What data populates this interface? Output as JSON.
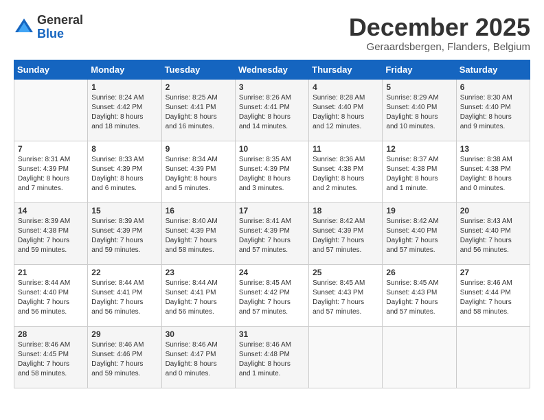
{
  "header": {
    "logo_line1": "General",
    "logo_line2": "Blue",
    "month_year": "December 2025",
    "location": "Geraardsbergen, Flanders, Belgium"
  },
  "weekdays": [
    "Sunday",
    "Monday",
    "Tuesday",
    "Wednesday",
    "Thursday",
    "Friday",
    "Saturday"
  ],
  "weeks": [
    [
      {
        "day": "",
        "info": ""
      },
      {
        "day": "1",
        "info": "Sunrise: 8:24 AM\nSunset: 4:42 PM\nDaylight: 8 hours\nand 18 minutes."
      },
      {
        "day": "2",
        "info": "Sunrise: 8:25 AM\nSunset: 4:41 PM\nDaylight: 8 hours\nand 16 minutes."
      },
      {
        "day": "3",
        "info": "Sunrise: 8:26 AM\nSunset: 4:41 PM\nDaylight: 8 hours\nand 14 minutes."
      },
      {
        "day": "4",
        "info": "Sunrise: 8:28 AM\nSunset: 4:40 PM\nDaylight: 8 hours\nand 12 minutes."
      },
      {
        "day": "5",
        "info": "Sunrise: 8:29 AM\nSunset: 4:40 PM\nDaylight: 8 hours\nand 10 minutes."
      },
      {
        "day": "6",
        "info": "Sunrise: 8:30 AM\nSunset: 4:40 PM\nDaylight: 8 hours\nand 9 minutes."
      }
    ],
    [
      {
        "day": "7",
        "info": "Sunrise: 8:31 AM\nSunset: 4:39 PM\nDaylight: 8 hours\nand 7 minutes."
      },
      {
        "day": "8",
        "info": "Sunrise: 8:33 AM\nSunset: 4:39 PM\nDaylight: 8 hours\nand 6 minutes."
      },
      {
        "day": "9",
        "info": "Sunrise: 8:34 AM\nSunset: 4:39 PM\nDaylight: 8 hours\nand 5 minutes."
      },
      {
        "day": "10",
        "info": "Sunrise: 8:35 AM\nSunset: 4:39 PM\nDaylight: 8 hours\nand 3 minutes."
      },
      {
        "day": "11",
        "info": "Sunrise: 8:36 AM\nSunset: 4:38 PM\nDaylight: 8 hours\nand 2 minutes."
      },
      {
        "day": "12",
        "info": "Sunrise: 8:37 AM\nSunset: 4:38 PM\nDaylight: 8 hours\nand 1 minute."
      },
      {
        "day": "13",
        "info": "Sunrise: 8:38 AM\nSunset: 4:38 PM\nDaylight: 8 hours\nand 0 minutes."
      }
    ],
    [
      {
        "day": "14",
        "info": "Sunrise: 8:39 AM\nSunset: 4:38 PM\nDaylight: 7 hours\nand 59 minutes."
      },
      {
        "day": "15",
        "info": "Sunrise: 8:39 AM\nSunset: 4:39 PM\nDaylight: 7 hours\nand 59 minutes."
      },
      {
        "day": "16",
        "info": "Sunrise: 8:40 AM\nSunset: 4:39 PM\nDaylight: 7 hours\nand 58 minutes."
      },
      {
        "day": "17",
        "info": "Sunrise: 8:41 AM\nSunset: 4:39 PM\nDaylight: 7 hours\nand 57 minutes."
      },
      {
        "day": "18",
        "info": "Sunrise: 8:42 AM\nSunset: 4:39 PM\nDaylight: 7 hours\nand 57 minutes."
      },
      {
        "day": "19",
        "info": "Sunrise: 8:42 AM\nSunset: 4:40 PM\nDaylight: 7 hours\nand 57 minutes."
      },
      {
        "day": "20",
        "info": "Sunrise: 8:43 AM\nSunset: 4:40 PM\nDaylight: 7 hours\nand 56 minutes."
      }
    ],
    [
      {
        "day": "21",
        "info": "Sunrise: 8:44 AM\nSunset: 4:40 PM\nDaylight: 7 hours\nand 56 minutes."
      },
      {
        "day": "22",
        "info": "Sunrise: 8:44 AM\nSunset: 4:41 PM\nDaylight: 7 hours\nand 56 minutes."
      },
      {
        "day": "23",
        "info": "Sunrise: 8:44 AM\nSunset: 4:41 PM\nDaylight: 7 hours\nand 56 minutes."
      },
      {
        "day": "24",
        "info": "Sunrise: 8:45 AM\nSunset: 4:42 PM\nDaylight: 7 hours\nand 57 minutes."
      },
      {
        "day": "25",
        "info": "Sunrise: 8:45 AM\nSunset: 4:43 PM\nDaylight: 7 hours\nand 57 minutes."
      },
      {
        "day": "26",
        "info": "Sunrise: 8:45 AM\nSunset: 4:43 PM\nDaylight: 7 hours\nand 57 minutes."
      },
      {
        "day": "27",
        "info": "Sunrise: 8:46 AM\nSunset: 4:44 PM\nDaylight: 7 hours\nand 58 minutes."
      }
    ],
    [
      {
        "day": "28",
        "info": "Sunrise: 8:46 AM\nSunset: 4:45 PM\nDaylight: 7 hours\nand 58 minutes."
      },
      {
        "day": "29",
        "info": "Sunrise: 8:46 AM\nSunset: 4:46 PM\nDaylight: 7 hours\nand 59 minutes."
      },
      {
        "day": "30",
        "info": "Sunrise: 8:46 AM\nSunset: 4:47 PM\nDaylight: 8 hours\nand 0 minutes."
      },
      {
        "day": "31",
        "info": "Sunrise: 8:46 AM\nSunset: 4:48 PM\nDaylight: 8 hours\nand 1 minute."
      },
      {
        "day": "",
        "info": ""
      },
      {
        "day": "",
        "info": ""
      },
      {
        "day": "",
        "info": ""
      }
    ]
  ]
}
